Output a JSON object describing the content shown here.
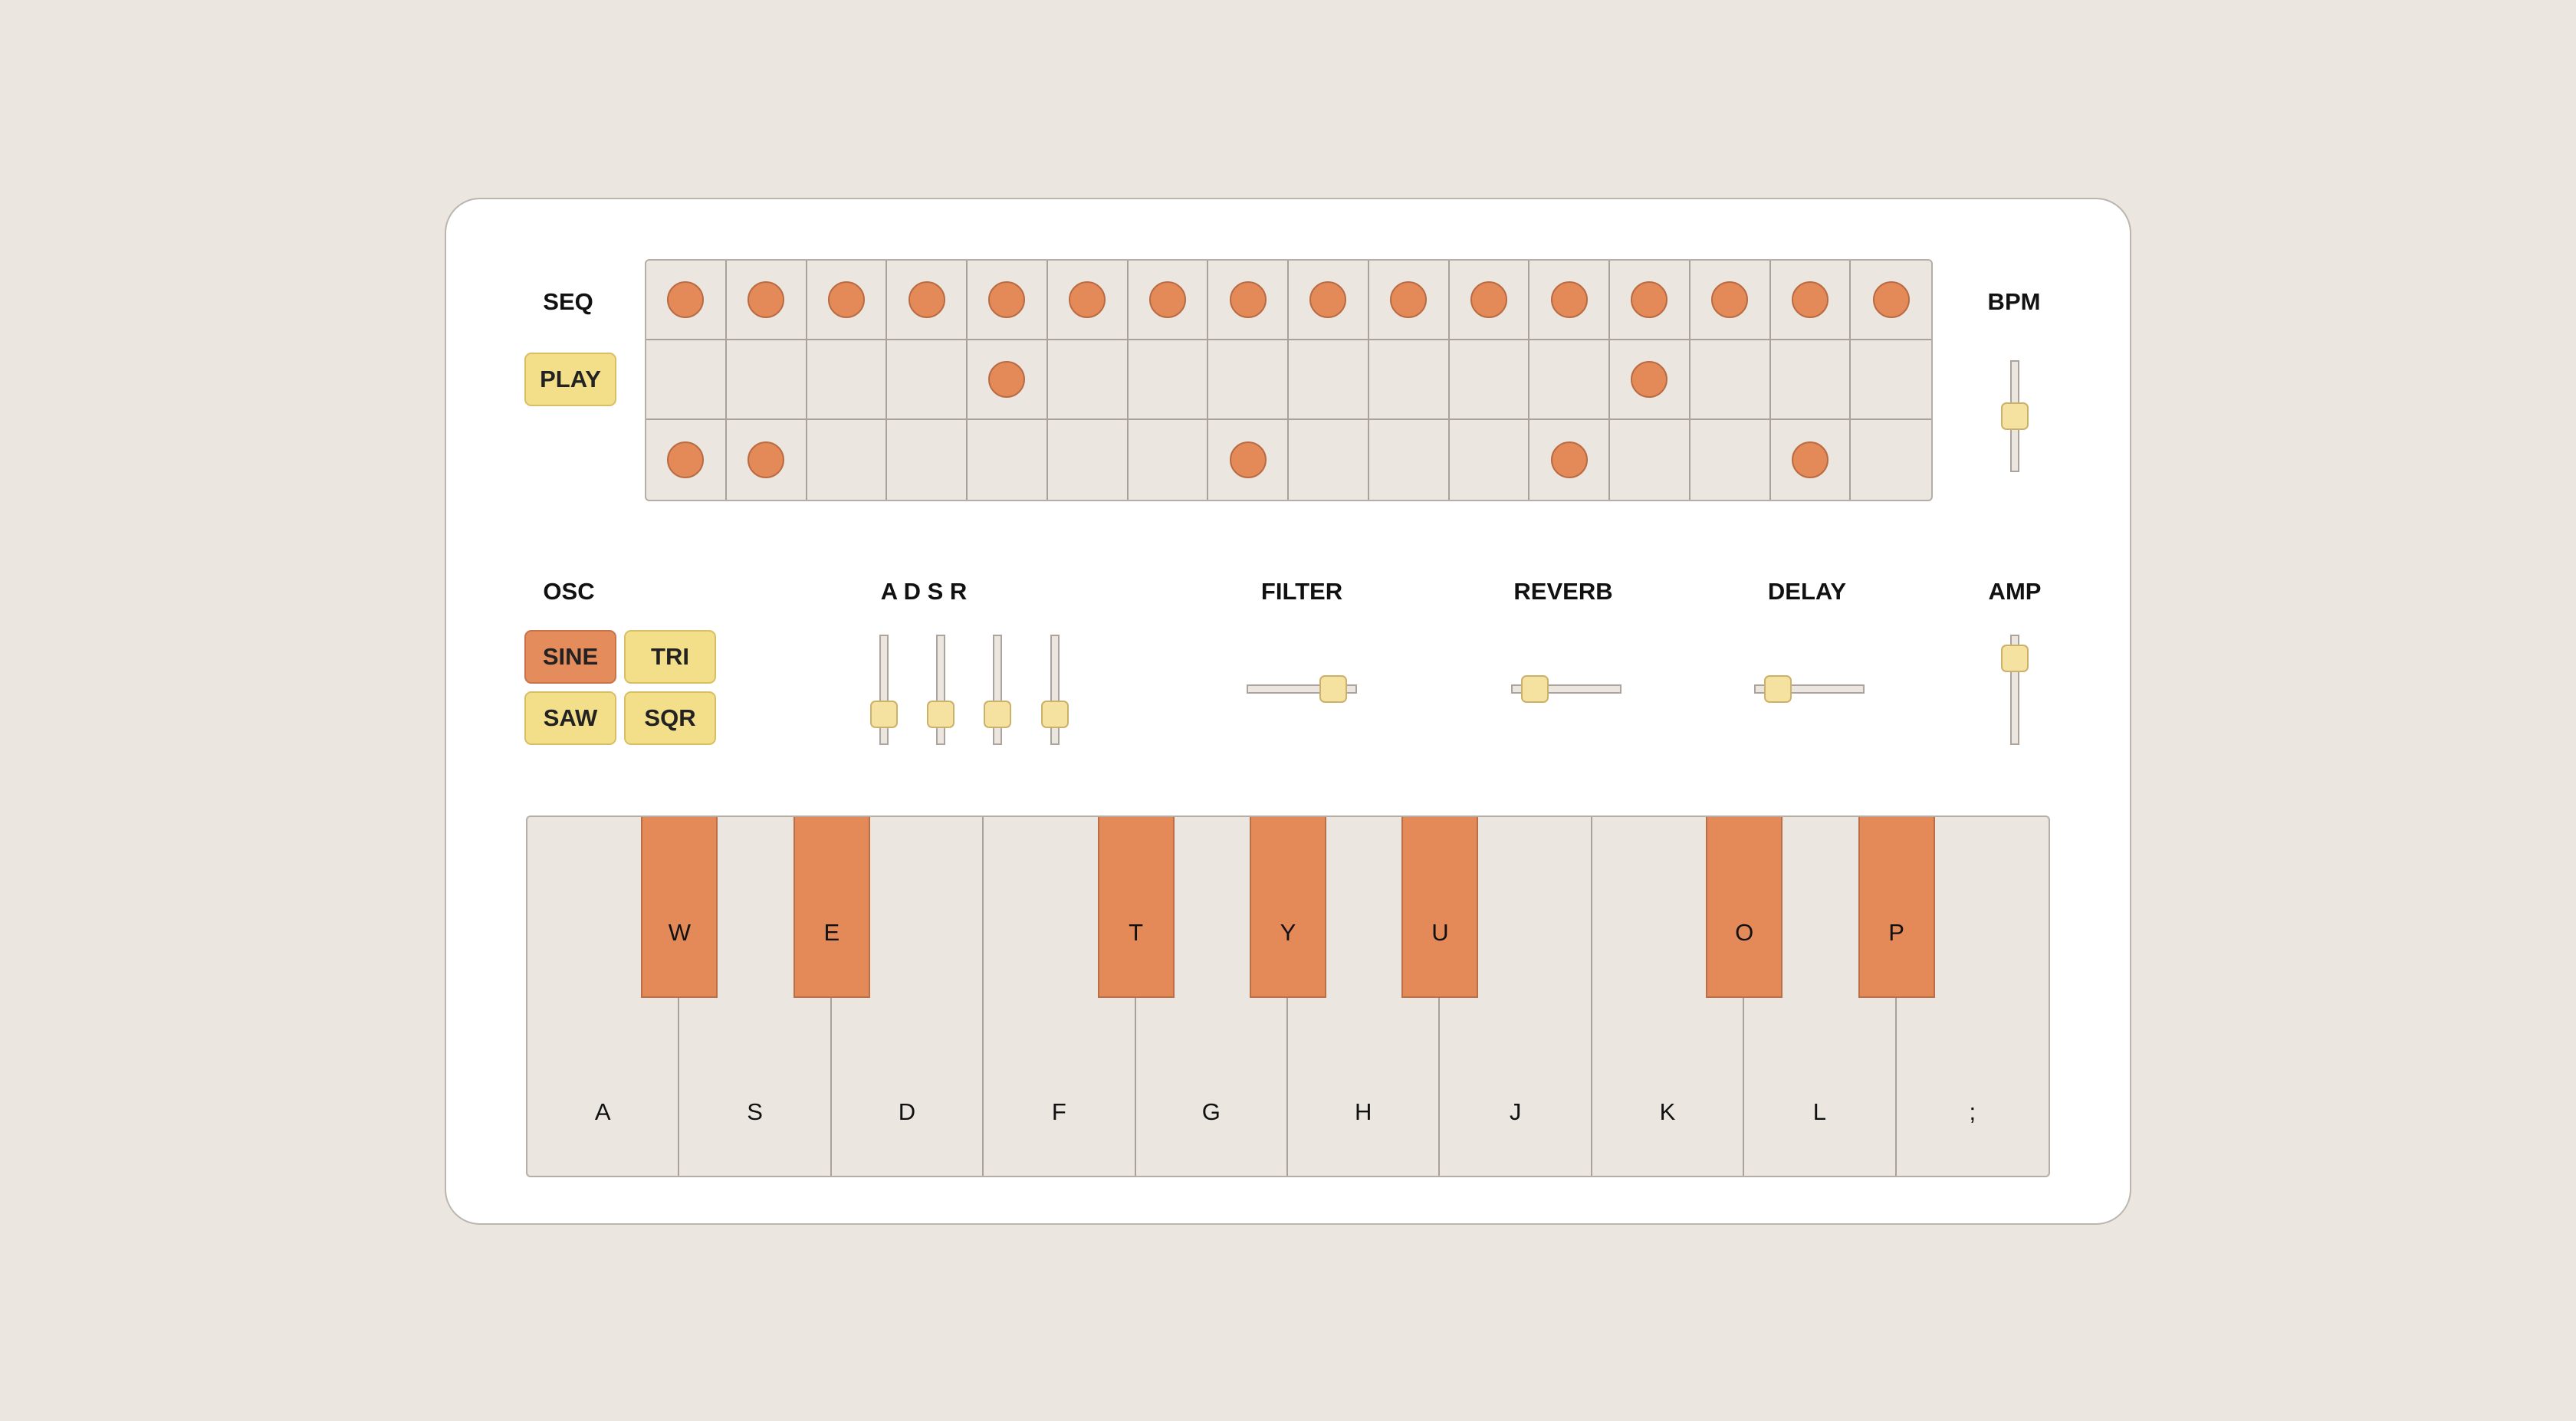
{
  "colors": {
    "background": "#ebe6e0",
    "panel": "#ffffff",
    "accent": "#e48a59",
    "button": "#f3de8a",
    "thumb": "#f5e2a0"
  },
  "sequencer": {
    "label": "SEQ",
    "play_label": "PLAY",
    "steps": 16,
    "rows": [
      [
        1,
        1,
        1,
        1,
        1,
        1,
        1,
        1,
        1,
        1,
        1,
        1,
        1,
        1,
        1,
        1
      ],
      [
        0,
        0,
        0,
        0,
        1,
        0,
        0,
        0,
        0,
        0,
        0,
        0,
        1,
        0,
        0,
        0
      ],
      [
        1,
        1,
        0,
        0,
        0,
        0,
        0,
        1,
        0,
        0,
        0,
        1,
        0,
        0,
        1,
        0
      ]
    ]
  },
  "bpm": {
    "label": "BPM",
    "value": 0.5
  },
  "osc": {
    "label": "OSC",
    "waveforms": [
      {
        "id": "sine",
        "label": "SINE",
        "active": true
      },
      {
        "id": "tri",
        "label": "TRI",
        "active": false
      },
      {
        "id": "saw",
        "label": "SAW",
        "active": false
      },
      {
        "id": "sqr",
        "label": "SQR",
        "active": false
      }
    ]
  },
  "adsr": {
    "label": "A D S R",
    "values": [
      0.2,
      0.2,
      0.2,
      0.2
    ]
  },
  "filter": {
    "label": "FILTER",
    "value": 0.88
  },
  "reverb": {
    "label": "REVERB",
    "value": 0.12
  },
  "delay": {
    "label": "DELAY",
    "value": 0.12
  },
  "amp": {
    "label": "AMP",
    "value": 0.88
  },
  "keyboard": {
    "white_keys": [
      "A",
      "S",
      "D",
      "F",
      "G",
      "H",
      "J",
      "K",
      "L",
      ";"
    ],
    "black_keys": [
      {
        "label": "W",
        "after": 0
      },
      {
        "label": "E",
        "after": 1
      },
      {
        "label": "T",
        "after": 3
      },
      {
        "label": "Y",
        "after": 4
      },
      {
        "label": "U",
        "after": 5
      },
      {
        "label": "O",
        "after": 7
      },
      {
        "label": "P",
        "after": 8
      }
    ]
  }
}
